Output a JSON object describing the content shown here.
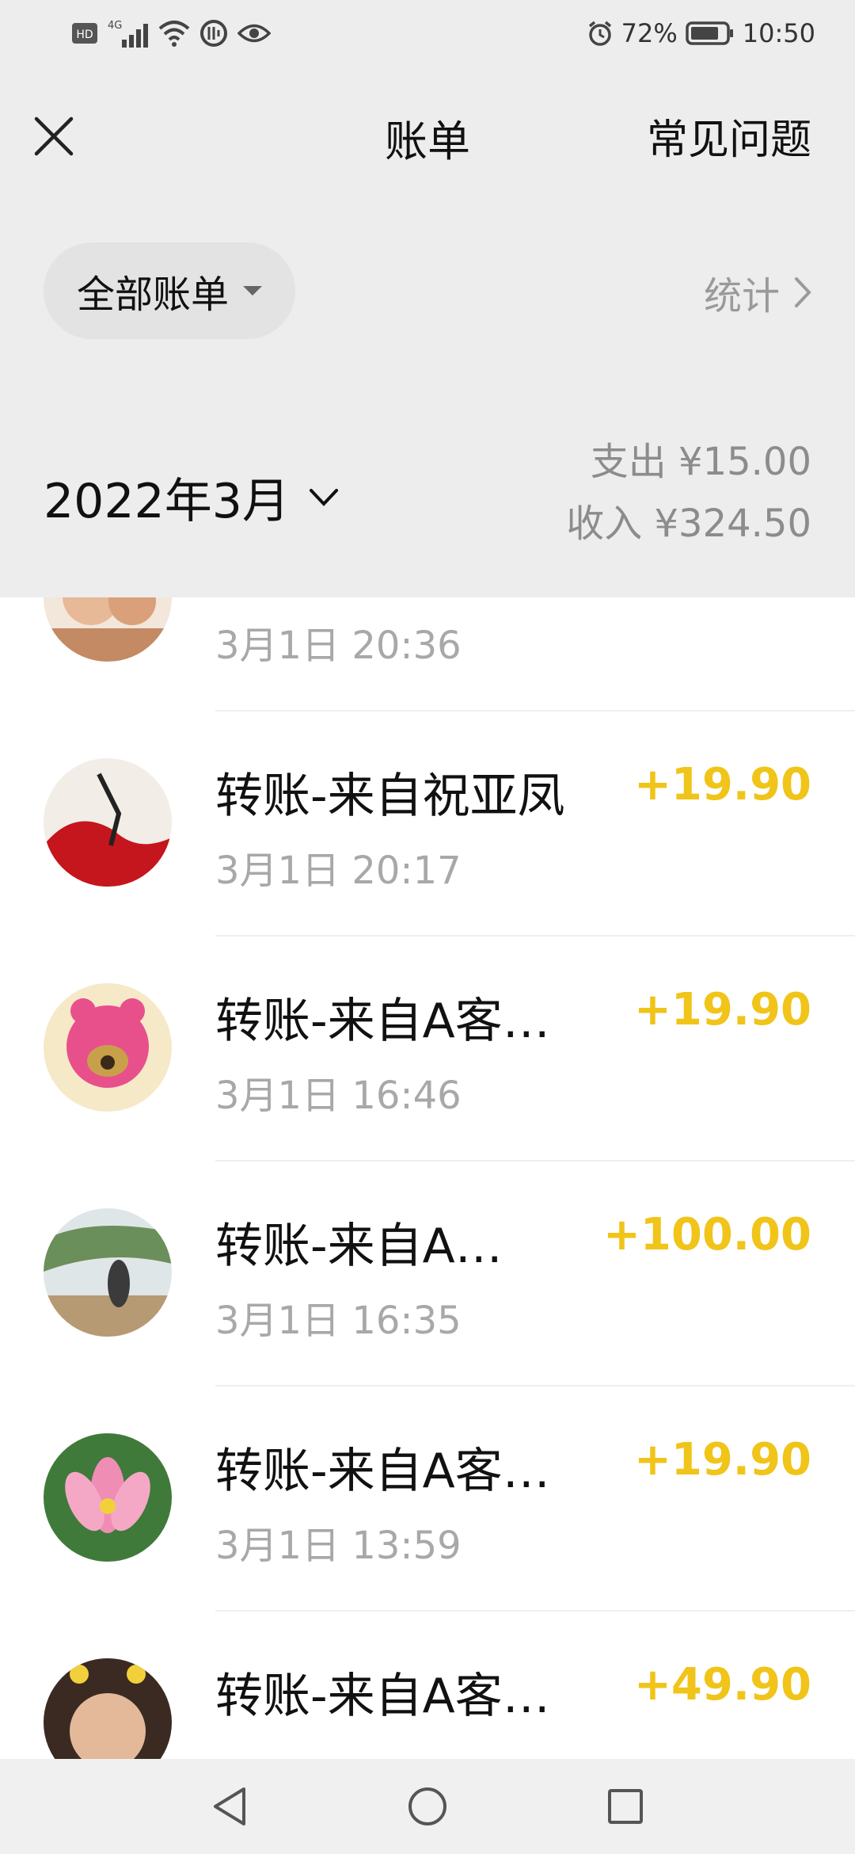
{
  "status_bar": {
    "left_icons": [
      "hd-icon",
      "signal-4g-icon",
      "wifi-icon",
      "data-saver-icon",
      "eye-comfort-icon"
    ],
    "net_label": "4G",
    "hd_label": "HD",
    "battery_percent": "72%",
    "time": "10:50"
  },
  "header": {
    "title": "账单",
    "faq_label": "常见问题",
    "filter_label": "全部账单",
    "stats_label": "统计",
    "month_label": "2022年3月",
    "expense": "支出 ¥15.00",
    "income": "收入 ¥324.50"
  },
  "transactions": [
    {
      "title": "",
      "time": "3月1日 20:36",
      "amount": "",
      "avatar_colors": [
        "#d9a07a",
        "#f3e6da"
      ]
    },
    {
      "title": "转账-来自祝亚凤",
      "time": "3月1日 20:17",
      "amount": "+19.90",
      "avatar_colors": [
        "#c4161c",
        "#f2ede6"
      ]
    },
    {
      "title": "转账-来自A客…",
      "time": "3月1日 16:46",
      "amount": "+19.90",
      "avatar_colors": [
        "#e8508c",
        "#f5e9c8"
      ]
    },
    {
      "title": "转账-来自A…",
      "time": "3月1日 16:35",
      "amount": "+100.00",
      "avatar_colors": [
        "#6b8f5a",
        "#dfe6e8"
      ]
    },
    {
      "title": "转账-来自A客…",
      "time": "3月1日 13:59",
      "amount": "+19.90",
      "avatar_colors": [
        "#f08db4",
        "#3f7a3a"
      ]
    },
    {
      "title": "转账-来自A客…",
      "time": "",
      "amount": "+49.90",
      "avatar_colors": [
        "#3a2a22",
        "#e4b99a"
      ]
    }
  ],
  "colors": {
    "income_amount": "#f0c419",
    "header_bg": "#ededed"
  },
  "nav": {
    "icons": [
      "back-triangle-icon",
      "home-circle-icon",
      "recents-square-icon"
    ]
  }
}
